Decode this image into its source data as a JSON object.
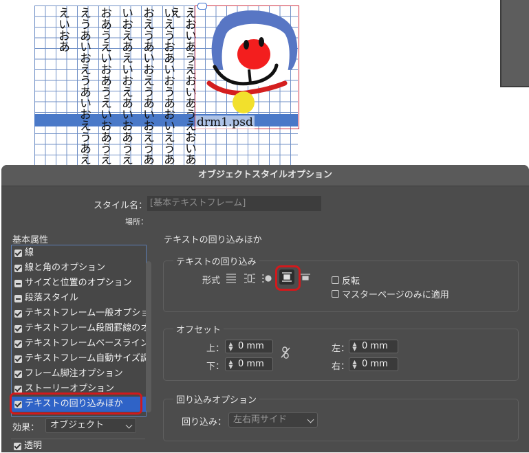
{
  "document": {
    "columns": [
      "えいおあ",
      "えうあいおえうあいおえうあえ",
      "おあうえいおあうえいおあうえ",
      "いおえあえいおえあいおあうえ",
      "おえうあいおえうあいおえうあ",
      "いえうおあいおうあおいえうあ",
      "えおいあうえおいあうえおいあえ"
    ],
    "placed_file": "drm1.psd"
  },
  "dialog": {
    "title": "オブジェクトスタイルオプション",
    "style_name_label": "スタイル名：",
    "style_name_value": "[基本テキストフレーム]",
    "location_label": "場所：",
    "basic_attributes_label": "基本属性",
    "attributes": [
      {
        "label": "線",
        "state": "checked"
      },
      {
        "label": "線と角のオプション",
        "state": "checked"
      },
      {
        "label": "サイズと位置のオプション",
        "state": "partial"
      },
      {
        "label": "段落スタイル",
        "state": "partial"
      },
      {
        "label": "テキストフレーム一般オプション",
        "state": "checked"
      },
      {
        "label": "テキストフレーム段間罫線のオプション",
        "state": "checked"
      },
      {
        "label": "テキストフレームベースラインオプション",
        "state": "checked"
      },
      {
        "label": "テキストフレーム自動サイズ調整オプション",
        "state": "checked"
      },
      {
        "label": "フレーム脚注オプション",
        "state": "checked"
      },
      {
        "label": "ストーリーオプション",
        "state": "checked"
      },
      {
        "label": "テキストの回り込みほか",
        "state": "checked",
        "selected": true
      }
    ],
    "effects_label": "効果：",
    "effects_value": "オブジェクト",
    "transparency_label": "透明",
    "section_title": "テキストの回り込みほか",
    "text_wrap_group": "テキストの回り込み",
    "format_label": "形式",
    "invert_label": "反転",
    "master_page_only_label": "マスターページのみに適用",
    "offset_group": "オフセット",
    "top_label": "上：",
    "bottom_label": "下：",
    "left_label": "左：",
    "right_label": "右：",
    "top_value": "0 mm",
    "bottom_value": "0 mm",
    "left_value": "0 mm",
    "right_value": "0 mm",
    "wrap_options_group": "回り込みオプション",
    "wrap_to_label": "回り込み：",
    "wrap_to_value": "左右両サイド"
  },
  "colors": {
    "highlight_red": "#d2191c",
    "grid_blue": "#6f8fc6",
    "dialog_bg": "#4c4c4c"
  }
}
